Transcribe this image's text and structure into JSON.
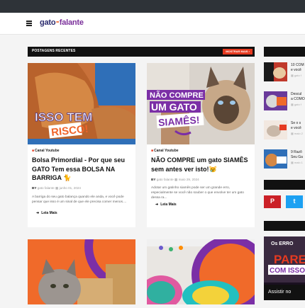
{
  "header": {
    "logo_part1": "gato",
    "logo_part2": "falante"
  },
  "section": {
    "title": "POSTAGENS RECENTES",
    "button": "MOSTRAR MAIS ›"
  },
  "posts": [
    {
      "thumb_text_1": "ISSO TEM",
      "thumb_text_2": "RISCO!",
      "category": "Canal Youtube",
      "title": "Bolsa Primordial - Por que seu GATO Tem essa BOLSA NA BARRIGA 🐈",
      "author_prefix": "BY",
      "author": "gato falante",
      "date": "junho 01, 2024",
      "excerpt": "A barriga do seu gato balança quando ele anda, e você pode pensar que isso é um sinal de que ele precisa comer menos....",
      "readmore": "Leia Mais"
    },
    {
      "thumb_text_1": "NÃO COMPRE",
      "thumb_text_2": "UM GATO",
      "thumb_text_3": "SIAMÊS!",
      "category": "Canal Youtube",
      "title": "NÃO COMPRE um gato SIAMÊS sem antes ver isto!😿",
      "author_prefix": "BY",
      "author": "gato falante",
      "date": "maio 29, 2024",
      "excerpt": "Adotar um gatinho siamês pode ser um grande erro, especialmente se você não souber o que envolve ter um gato dessa ra...",
      "readmore": "Leia Mais"
    }
  ],
  "sidebar": {
    "items": [
      {
        "text": "10 COM",
        "text2": "e você",
        "meta": "gato f"
      },
      {
        "text": "Descul",
        "text2": "a COMO",
        "meta": "gato f"
      },
      {
        "text": "Se o s",
        "text2": "e você",
        "meta": "maio 2"
      },
      {
        "text": "9 Razõ",
        "text2": "Seu Ga",
        "meta": "maio 1"
      }
    ],
    "video_text_1": "Os ERRO",
    "video_text_2": "PARE",
    "video_text_3": "COM ISSO",
    "video_watch": "Assistir no"
  },
  "colors": {
    "accent": "#e63a20",
    "pinterest": "#cb2027",
    "twitter": "#1da1f2"
  }
}
